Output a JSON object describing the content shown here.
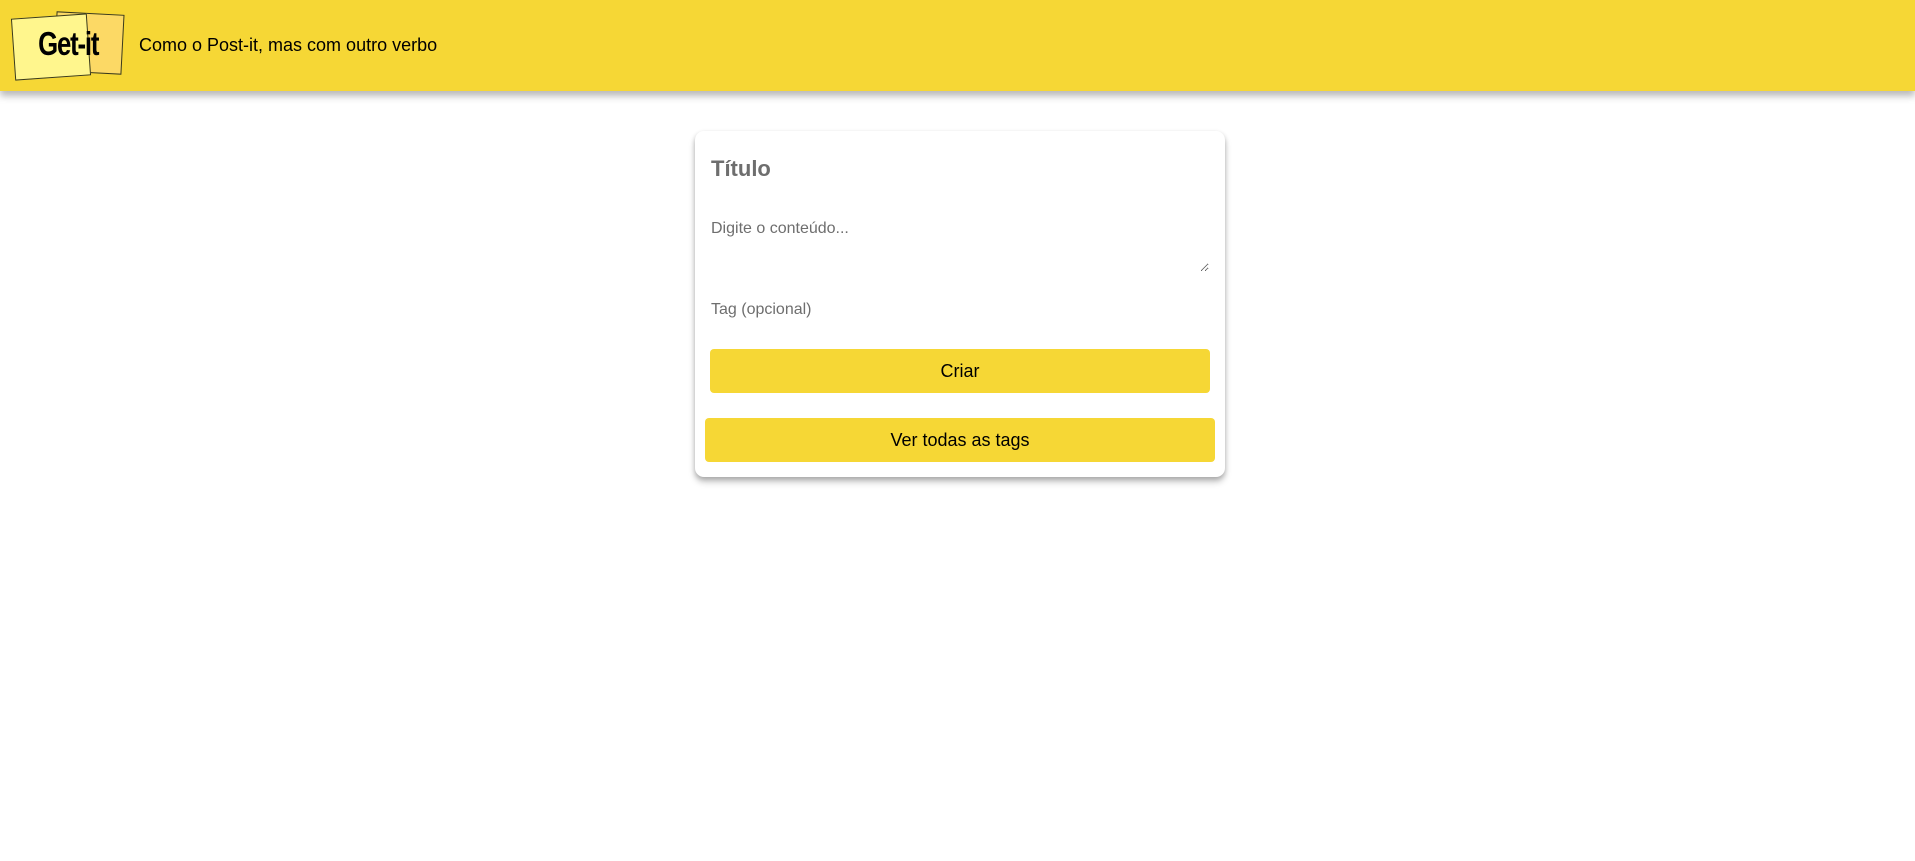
{
  "header": {
    "logo_text": "Get-it",
    "tagline": "Como o Post-it, mas com outro verbo",
    "color": "#f6d735"
  },
  "note_form": {
    "title_placeholder": "Título",
    "content_placeholder": "Digite o conteúdo...",
    "tag_placeholder": "Tag (opcional)",
    "create_label": "Criar",
    "all_tags_label": "Ver todas as tags",
    "button_color": "#f6d735"
  }
}
